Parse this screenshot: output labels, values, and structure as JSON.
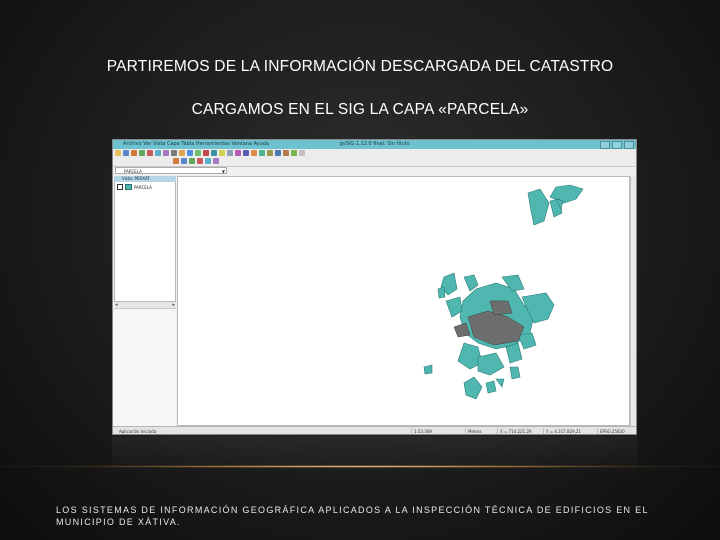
{
  "slide": {
    "title_line1": "PARTIREMOS DE LA INFORMACIÓN DESCARGADA DEL CATASTRO",
    "title_line2": "CARGAMOS EN EL SIG LA CAPA «PARCELA»",
    "footer": "LOS SISTEMAS DE INFORMACIÓN GEOGRÁFICA APLICADOS A LA INSPECCIÓN TÉCNICA DE EDIFICIOS EN EL MUNICIPIO DE XÀTIVA."
  },
  "app": {
    "window_title": "gvSIG 1.12.0 final: Sin título",
    "menu": "Archivo  Ver  Vista  Capa  Tabla  Herramientas  Ventana  Ayuda",
    "view_selector": "PARCELA",
    "view_header": "Vista: PERXAT",
    "layer_name": "PARCELA",
    "layer_color": "#4fb7b0",
    "status": {
      "left": "Aplicación Iniciada",
      "scale": "1:53.309",
      "units": "Metros",
      "x": "X = 714.221,29",
      "y": "Y = 4.317.829,21",
      "crs": "EPSG:25830"
    }
  }
}
